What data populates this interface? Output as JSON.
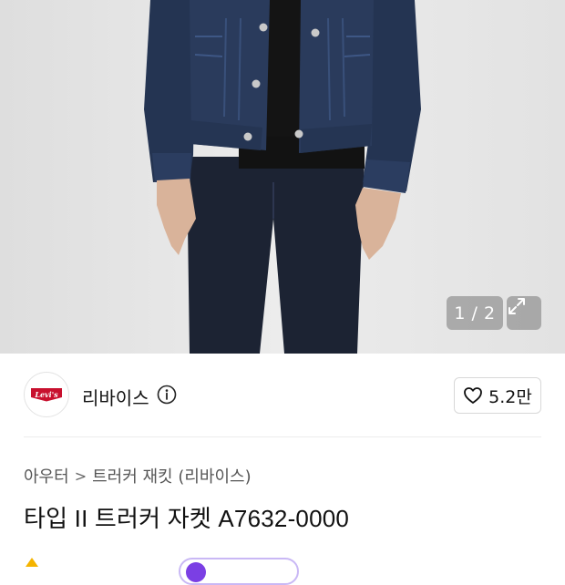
{
  "gallery": {
    "counter": "1 / 2",
    "expand_icon": "expand-icon",
    "background_color": "#e4e4e4"
  },
  "brand": {
    "logo_text": "Levi's",
    "logo_color": "#c8102e",
    "name": "리바이스",
    "info_icon": "info-icon",
    "likes": "5.2만",
    "like_icon": "heart-icon"
  },
  "breadcrumb": {
    "category": "아우터",
    "separator": ">",
    "subcategory": "트러커 재킷 (리바이스)"
  },
  "product": {
    "title": "타입 II 트러커 자켓 A7632-0000"
  }
}
